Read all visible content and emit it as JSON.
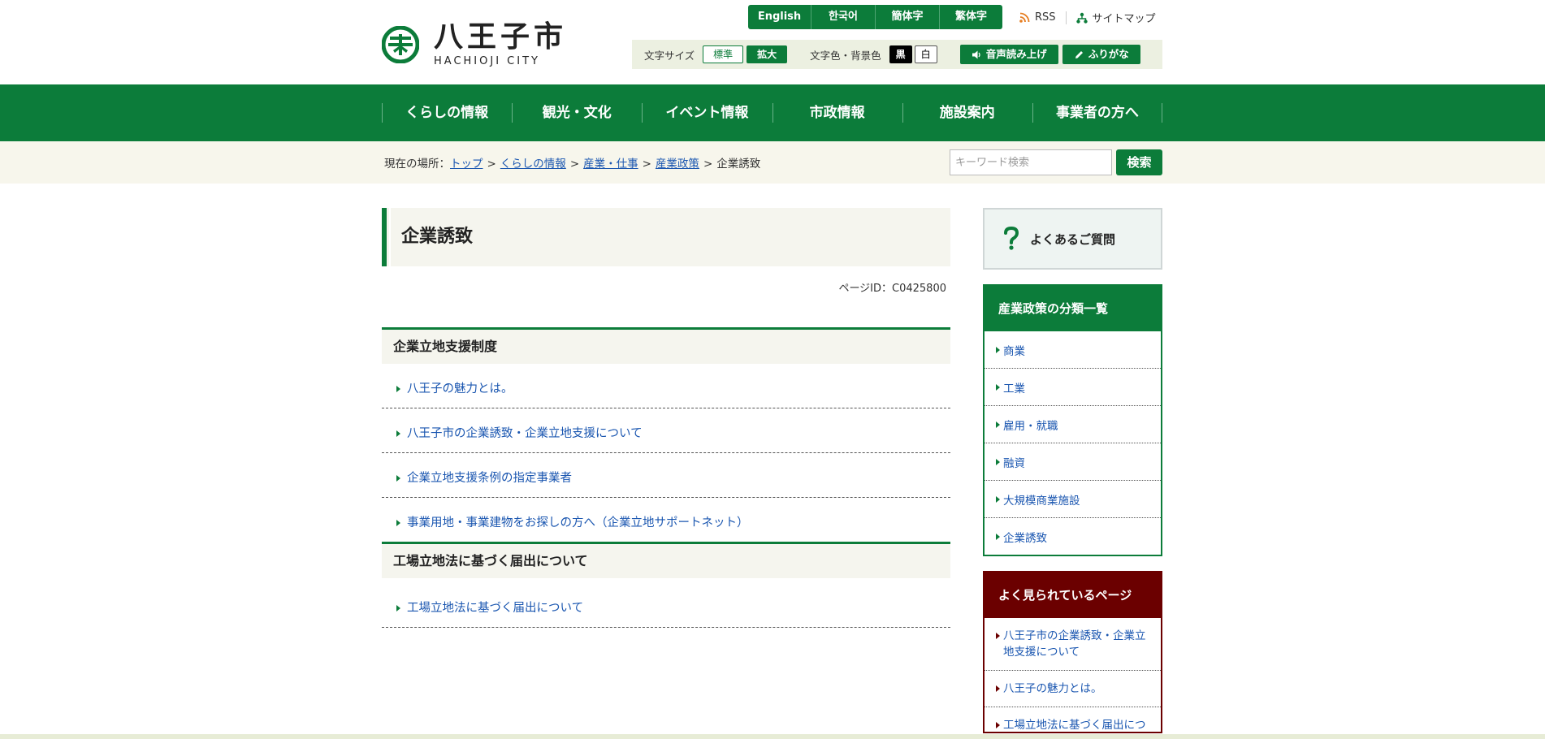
{
  "logo": {
    "main": "八王子市",
    "sub": "HACHIOJI CITY"
  },
  "languages": [
    "English",
    "한국어",
    "簡体字",
    "繁体字"
  ],
  "top_links": {
    "rss": "RSS",
    "sitemap": "サイトマップ"
  },
  "tools": {
    "text_size_label": "文字サイズ",
    "size_standard": "標準",
    "size_large": "拡大",
    "color_label": "文字色・背景色",
    "color_black": "黒",
    "color_white": "白",
    "read_aloud": "音声読み上げ",
    "furigana": "ふりがな"
  },
  "global_nav": [
    "くらしの情報",
    "観光・文化",
    "イベント情報",
    "市政情報",
    "施設案内",
    "事業者の方へ"
  ],
  "breadcrumb": {
    "label": "現在の場所：",
    "items": [
      "トップ",
      "くらしの情報",
      "産業・仕事",
      "産業政策"
    ],
    "current": "企業誘致"
  },
  "search": {
    "placeholder": "キーワード検索",
    "button": "検索"
  },
  "page": {
    "title": "企業誘致",
    "page_id": "ページID：C0425800"
  },
  "sections": [
    {
      "heading": "企業立地支援制度",
      "links": [
        "八王子の魅力とは。",
        "八王子市の企業誘致・企業立地支援について",
        "企業立地支援条例の指定事業者",
        "事業用地・事業建物をお探しの方へ（企業立地サポートネット）"
      ]
    },
    {
      "heading": "工場立地法に基づく届出について",
      "links": [
        "工場立地法に基づく届出について"
      ]
    }
  ],
  "sidebar": {
    "faq": "よくあるご質問",
    "category": {
      "heading": "産業政策の分類一覧",
      "items": [
        "商業",
        "工業",
        "雇用・就職",
        "融資",
        "大規模商業施設",
        "企業誘致"
      ]
    },
    "popular": {
      "heading": "よく見られているページ",
      "items": [
        "八王子市の企業誘致・企業立地支援について",
        "八王子の魅力とは。",
        "工場立地法に基づく届出について"
      ]
    }
  },
  "colors": {
    "brand_green": "#0c7c3a",
    "popular_red": "#6b0000",
    "link_blue": "#1a56b0",
    "band_beige": "#f7f6ec"
  }
}
